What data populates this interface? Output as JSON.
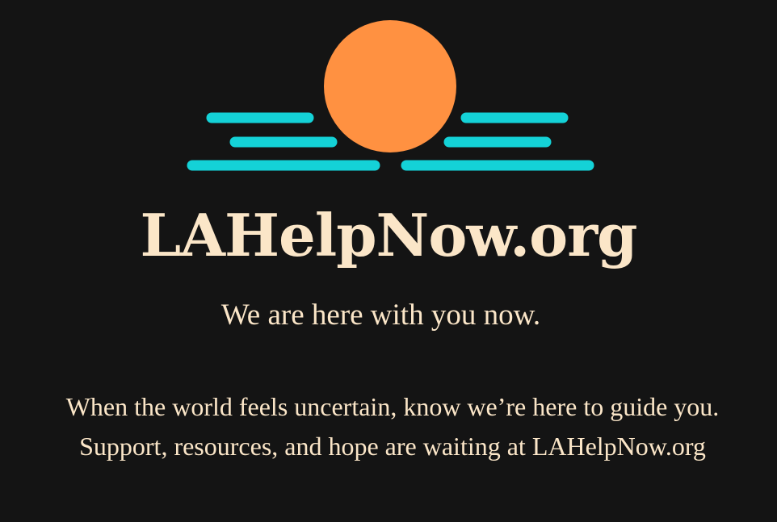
{
  "colors": {
    "background": "#141414",
    "sun": "#ff9141",
    "waves": "#14d2d7",
    "text": "#fbe6c8"
  },
  "logo": {
    "icon": "sun-over-water-icon"
  },
  "site_title": "LAHelpNow.org",
  "tagline": "We are here with you now.",
  "body_text": "When the world feels uncertain, know we’re here to guide you. Support, resources, and hope are waiting at LAHelpNow.org"
}
